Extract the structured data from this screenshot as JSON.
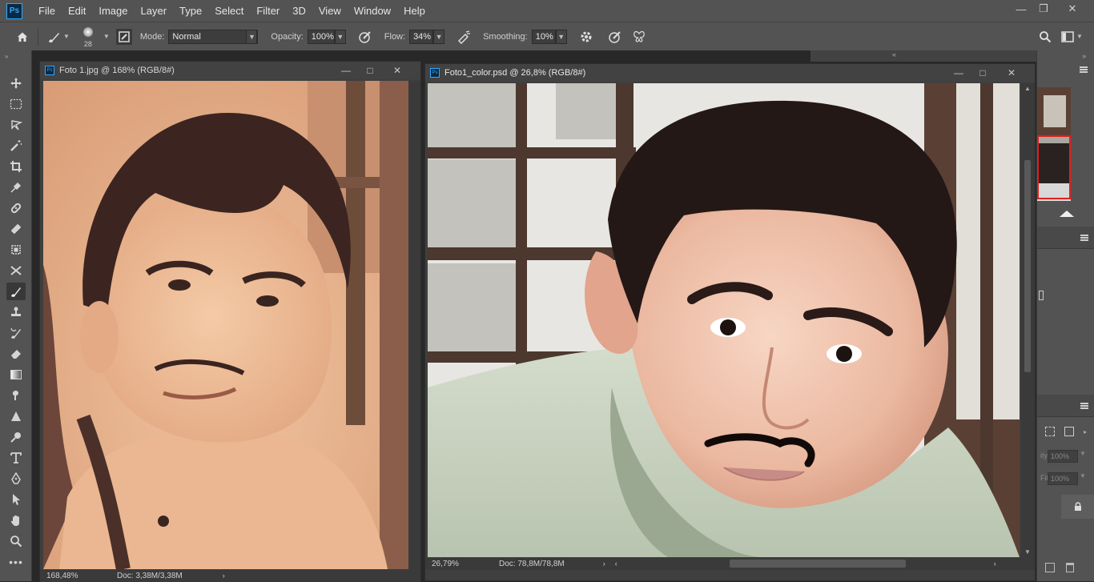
{
  "app": {
    "logo_text": "Ps"
  },
  "menu": [
    "File",
    "Edit",
    "Image",
    "Layer",
    "Type",
    "Select",
    "Filter",
    "3D",
    "View",
    "Window",
    "Help"
  ],
  "window_controls": {
    "minimize": "—",
    "restore": "❐",
    "close": "✕"
  },
  "options": {
    "brush_size": "28",
    "mode_label": "Mode:",
    "mode_value": "Normal",
    "opacity_label": "Opacity:",
    "opacity_value": "100%",
    "flow_label": "Flow:",
    "flow_value": "34%",
    "smoothing_label": "Smoothing:",
    "smoothing_value": "10%"
  },
  "docs": [
    {
      "title": "Foto 1.jpg @ 168% (RGB/8#)",
      "zoom": "168,48%",
      "doc_size": "Doc: 3,38M/3,38M"
    },
    {
      "title": "Foto1_color.psd @ 26,8% (RGB/8#)",
      "zoom": "26,79%",
      "doc_size": "Doc: 78,8M/78,8M"
    }
  ],
  "panels": {
    "opacity_ghost": "ity:",
    "opacity_value": "100%",
    "fill_ghost": "Fill:",
    "fill_value": "100%"
  },
  "colors": {
    "chrome": "#535353",
    "workspace": "#282828",
    "accent": "#31a8ff"
  }
}
